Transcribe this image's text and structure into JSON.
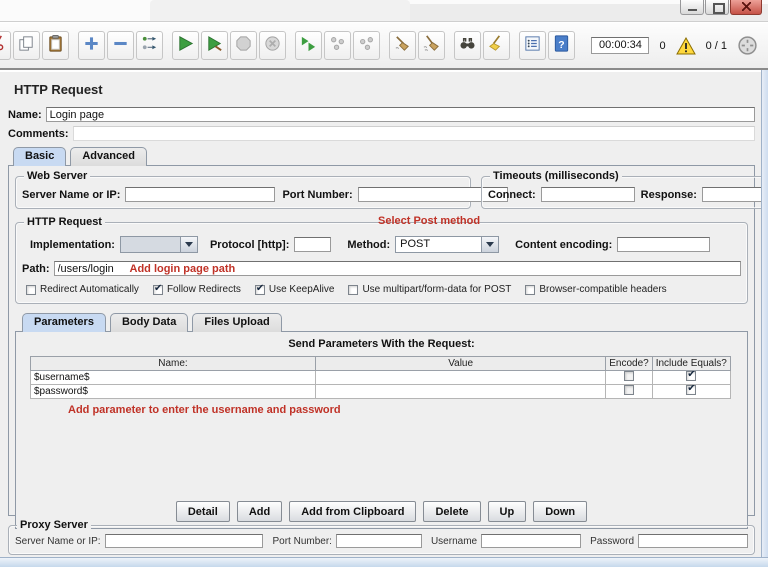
{
  "window": {
    "controls": [
      "minimize",
      "maximize",
      "close"
    ]
  },
  "toolbar": {
    "timer": "00:00:34",
    "warning_count": "0",
    "thread_count": "0 / 1",
    "icons": [
      "cut-icon",
      "copy-icon",
      "paste-icon",
      "expand-all-icon",
      "collapse-all-icon",
      "toggle-icon",
      "start-icon",
      "start-no-pauses-icon",
      "stop-icon",
      "shutdown-icon",
      "remote-start-all-icon",
      "remote-stop-all-icon",
      "remote-shutdown-all-icon",
      "clear-icon",
      "clear-all-icon",
      "search-icon",
      "search-reset-icon",
      "function-helper-icon",
      "help-icon",
      "warning-triangle-icon",
      "status-indicator-icon"
    ]
  },
  "header": {
    "title": "HTTP Request"
  },
  "name_row": {
    "label": "Name:",
    "value": "Login page"
  },
  "comments_row": {
    "label": "Comments:",
    "value": ""
  },
  "tabs": {
    "basic": "Basic",
    "advanced": "Advanced"
  },
  "web_server": {
    "title": "Web Server",
    "server_label": "Server Name or IP:",
    "server_value": "",
    "port_label": "Port Number:",
    "port_value": ""
  },
  "timeouts": {
    "title": "Timeouts (milliseconds)",
    "connect_label": "Connect:",
    "connect_value": "",
    "response_label": "Response:",
    "response_value": ""
  },
  "http_request": {
    "title": "HTTP Request",
    "implementation_label": "Implementation:",
    "implementation_value": "",
    "protocol_label": "Protocol [http]:",
    "protocol_value": "",
    "method_label": "Method:",
    "method_value": "POST",
    "content_encoding_label": "Content encoding:",
    "content_encoding_value": "",
    "path_label": "Path:",
    "path_value": "/users/login",
    "checkboxes": [
      {
        "label": "Redirect Automatically",
        "checked": false
      },
      {
        "label": "Follow Redirects",
        "checked": true
      },
      {
        "label": "Use KeepAlive",
        "checked": true
      },
      {
        "label": "Use multipart/form-data for POST",
        "checked": false
      },
      {
        "label": "Browser-compatible headers",
        "checked": false
      }
    ]
  },
  "annotations": {
    "method": "Select Post method",
    "path": "Add login page path",
    "parameters": "Add parameter to enter the username and password",
    "color": "#c03227"
  },
  "param_tabs": {
    "parameters": "Parameters",
    "body_data": "Body Data",
    "files_upload": "Files Upload"
  },
  "parameters_panel": {
    "title": "Send Parameters With the Request:",
    "table": {
      "headers": [
        "Name:",
        "Value",
        "Encode?",
        "Include Equals?"
      ],
      "rows": [
        {
          "name": "$username$",
          "value_redacted": true,
          "encode": false,
          "include_equals": true
        },
        {
          "name": "$password$",
          "value_redacted": true,
          "encode": false,
          "include_equals": true
        }
      ]
    },
    "buttons": [
      "Detail",
      "Add",
      "Add from Clipboard",
      "Delete",
      "Up",
      "Down"
    ]
  },
  "proxy": {
    "title": "Proxy Server",
    "server_label": "Server Name or IP:",
    "server_value": "",
    "port_label": "Port Number:",
    "port_value": "",
    "username_label": "Username",
    "username_value": "",
    "password_label": "Password",
    "password_value": ""
  },
  "colors": {
    "redaction": "#ea1515",
    "annotation": "#c03227",
    "tab_selected": "#c8daf2",
    "warning": "#ffd83d"
  }
}
